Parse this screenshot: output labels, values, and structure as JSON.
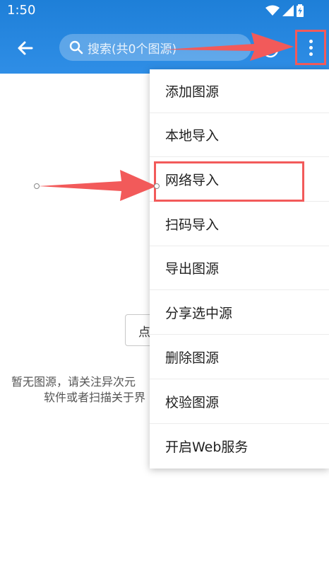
{
  "status_bar": {
    "time": "1:50",
    "icons": [
      "wifi-icon",
      "signal-icon",
      "battery-charging-icon"
    ]
  },
  "header": {
    "back_icon": "arrow-left-icon",
    "search_icon": "search-icon",
    "search_placeholder": "搜索(共0个图源)",
    "sync_icon": "sync-icon",
    "more_icon": "more-vertical-icon"
  },
  "page": {
    "empty_button_label": "点",
    "empty_line_1": "暂无图源，请关注异次元",
    "empty_line_2": "软件或者扫描关于界"
  },
  "menu": {
    "items": [
      {
        "label": "添加图源"
      },
      {
        "label": "本地导入"
      },
      {
        "label": "网络导入"
      },
      {
        "label": "扫码导入"
      },
      {
        "label": "导出图源"
      },
      {
        "label": "分享选中源"
      },
      {
        "label": "删除图源"
      },
      {
        "label": "校验图源"
      },
      {
        "label": "开启Web服务"
      }
    ]
  },
  "colors": {
    "header": "#2f8ee6",
    "annotation": "#f25a5a"
  }
}
